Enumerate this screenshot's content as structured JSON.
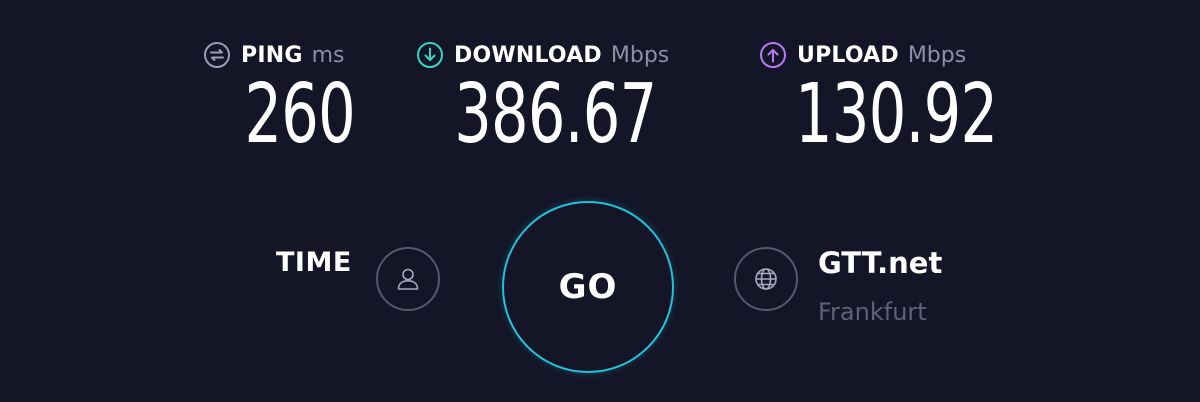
{
  "metrics": {
    "ping": {
      "label": "PING",
      "unit": "ms",
      "value": "260",
      "icon": "ping-icon",
      "color": "#9b9eb3"
    },
    "download": {
      "label": "DOWNLOAD",
      "unit": "Mbps",
      "value": "386.67",
      "icon": "download-arrow-icon",
      "color": "#37d5c4"
    },
    "upload": {
      "label": "UPLOAD",
      "unit": "Mbps",
      "value": "130.92",
      "icon": "upload-arrow-icon",
      "color": "#b67bf0"
    }
  },
  "controls": {
    "time_label": "TIME",
    "user_icon": "user-icon",
    "go_label": "GO",
    "go_color": "#23c2d8",
    "globe_icon": "globe-icon"
  },
  "server": {
    "provider": "GTT.net",
    "location": "Frankfurt"
  },
  "colors": {
    "background": "#141526",
    "muted_text": "#8c8fa8",
    "dim_text": "#5e6178"
  }
}
